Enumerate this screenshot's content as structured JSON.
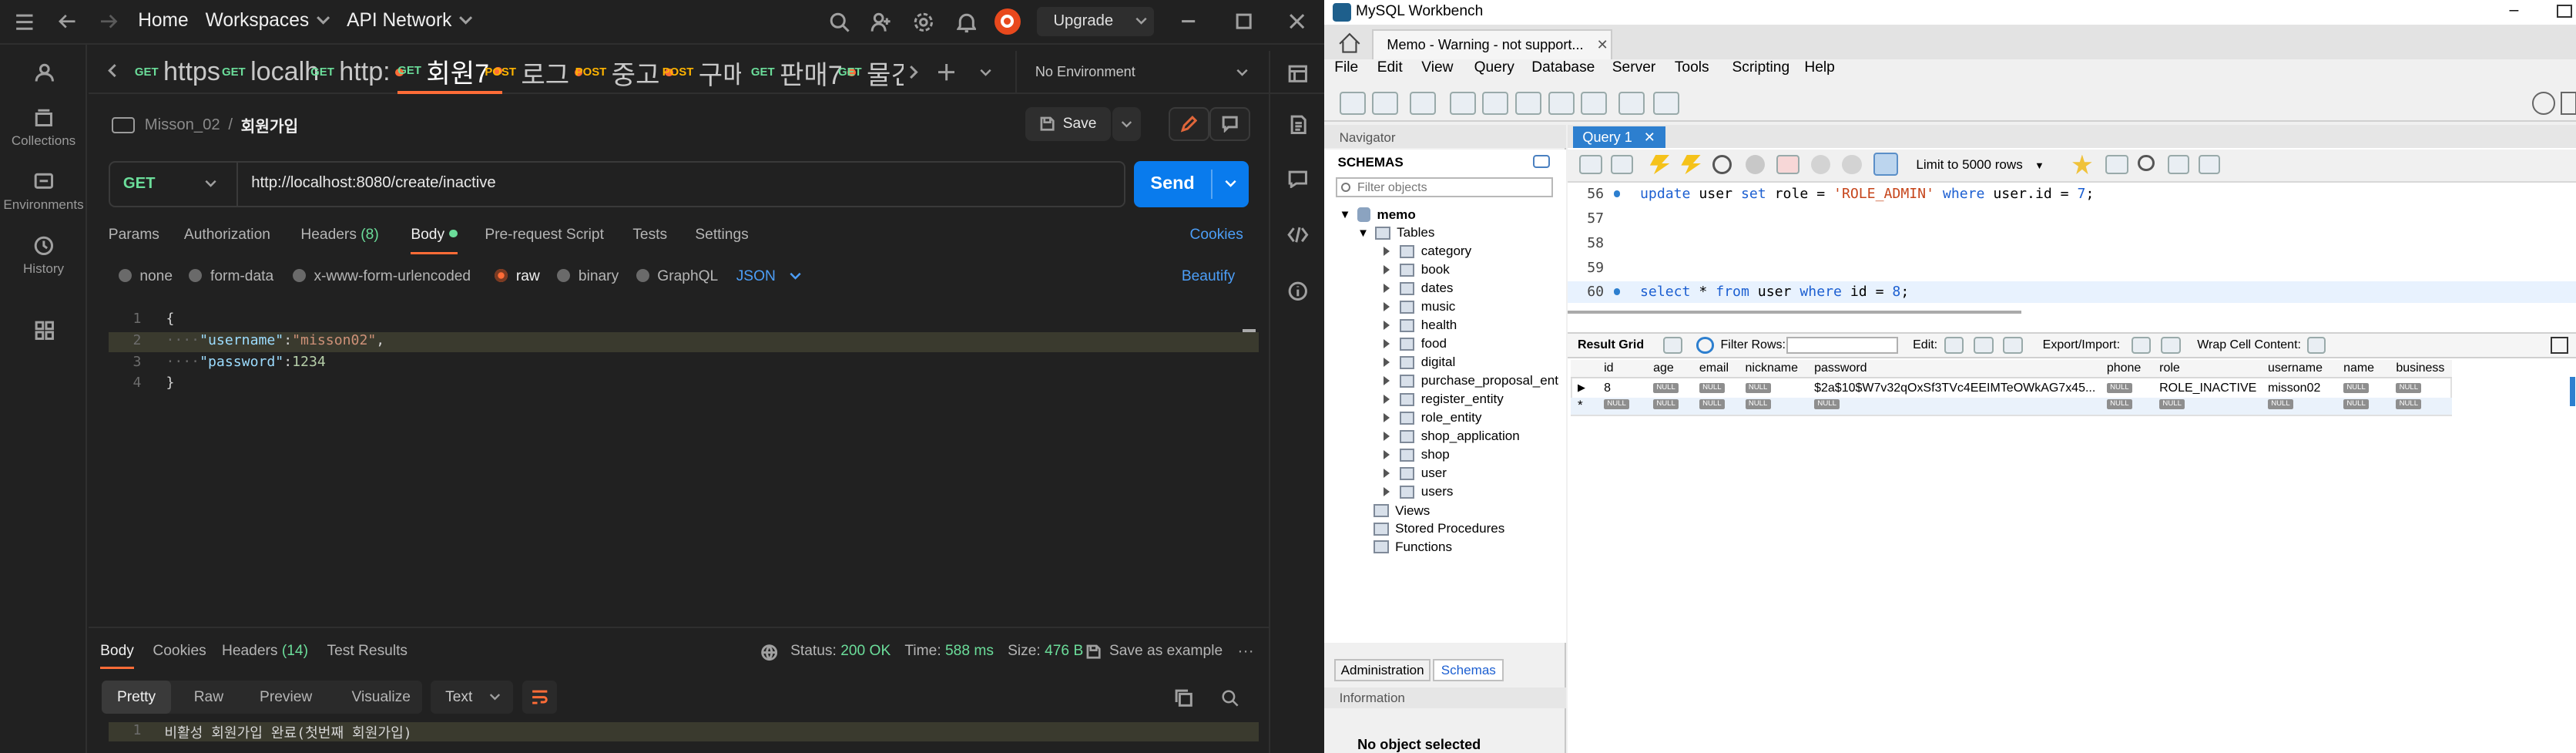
{
  "postman": {
    "titlebar": {
      "home": "Home",
      "workspaces": "Workspaces",
      "api_network": "API Network",
      "upgrade": "Upgrade"
    },
    "sidebar": [
      {
        "label": "Collections"
      },
      {
        "label": "Environments"
      },
      {
        "label": "History"
      }
    ],
    "tabs": [
      {
        "method": "GET",
        "name": "https",
        "dot": false
      },
      {
        "method": "GET",
        "name": "localh",
        "dot": false
      },
      {
        "method": "GET",
        "name": "http:",
        "dot": true
      },
      {
        "method": "GET",
        "name": "회원7",
        "dot": true,
        "active": true
      },
      {
        "method": "POST",
        "name": "로그",
        "dot": true
      },
      {
        "method": "POST",
        "name": "중고",
        "dot": true
      },
      {
        "method": "POST",
        "name": "구매자",
        "dot": false
      },
      {
        "method": "GET",
        "name": "판매7",
        "dot": true
      },
      {
        "method": "GET",
        "name": "물건",
        "dot": false
      }
    ],
    "environment": "No Environment",
    "breadcrumb": {
      "collection": "Misson_02",
      "separator": "/",
      "request": "회원가입"
    },
    "save": "Save",
    "request": {
      "method": "GET",
      "url": "http://localhost:8080/create/inactive",
      "send": "Send"
    },
    "req_tabs": [
      "Params",
      "Authorization",
      "Headers",
      "Body",
      "Pre-request Script",
      "Tests",
      "Settings"
    ],
    "headers_count": "(8)",
    "cookies": "Cookies",
    "body_types": [
      "none",
      "form-data",
      "x-www-form-urlencoded",
      "raw",
      "binary",
      "GraphQL"
    ],
    "body_format": "JSON",
    "beautify": "Beautify",
    "body_lines": [
      {
        "n": "1",
        "text": "{"
      },
      {
        "n": "2",
        "key": "\"username\"",
        "colon": ": ",
        "val": "\"misson02\"",
        "tail": ","
      },
      {
        "n": "3",
        "key": "\"password\"",
        "colon": ": ",
        "val": "1234",
        "tail": ""
      },
      {
        "n": "4",
        "text": "}"
      }
    ],
    "resp_tabs": [
      "Body",
      "Cookies",
      "Headers",
      "Test Results"
    ],
    "resp_headers_count": "(14)",
    "status": {
      "status_label": "Status:",
      "status": "200 OK",
      "time_label": "Time:",
      "time": "588 ms",
      "size_label": "Size:",
      "size": "476 B",
      "save_example": "Save as example"
    },
    "view_tabs": [
      "Pretty",
      "Raw",
      "Preview",
      "Visualize"
    ],
    "resp_format": "Text",
    "resp_line": {
      "n": "1",
      "text": "비활성 회원가입 완료(첫번째 회원가입)"
    }
  },
  "workbench": {
    "title": "MySQL Workbench",
    "conn_tab": "Memo - Warning - not support...",
    "menu": [
      "File",
      "Edit",
      "View",
      "Query",
      "Database",
      "Server",
      "Tools",
      "Scripting",
      "Help"
    ],
    "navigator": "Navigator",
    "schemas": "SCHEMAS",
    "filter_placeholder": "Filter objects",
    "schema": "memo",
    "tables_label": "Tables",
    "tables": [
      "category",
      "book",
      "dates",
      "music",
      "health",
      "food",
      "digital",
      "purchase_proposal_ent",
      "register_entity",
      "role_entity",
      "shop_application",
      "shop",
      "user",
      "users"
    ],
    "others": [
      "Views",
      "Stored Procedures",
      "Functions"
    ],
    "query_tab": "Query 1",
    "limit": "Limit to 5000 rows",
    "sql": [
      {
        "n": "56",
        "dot": true,
        "text": "update user set role = 'ROLE_ADMIN' where user.id = 7;"
      },
      {
        "n": "57",
        "dot": false,
        "text": ""
      },
      {
        "n": "58",
        "dot": false,
        "text": ""
      },
      {
        "n": "59",
        "dot": false,
        "text": ""
      },
      {
        "n": "60",
        "dot": true,
        "text": "select * from user where id = 8;"
      }
    ],
    "result_grid": "Result Grid",
    "filter_rows": "Filter Rows:",
    "edit": "Edit:",
    "export": "Export/Import:",
    "wrap": "Wrap Cell Content:",
    "columns": [
      "id",
      "age",
      "email",
      "nickname",
      "password",
      "phone",
      "role",
      "username",
      "name",
      "business"
    ],
    "row": {
      "id": "8",
      "password": "$2a$10$W7v32qOxSf3TVc4EEIMTeOWkAG7x45...",
      "role": "ROLE_INACTIVE",
      "username": "misson02"
    },
    "null": "NULL",
    "bottom_tabs": [
      "Administration",
      "Schemas"
    ],
    "information": "Information",
    "no_object": "No object selected"
  }
}
